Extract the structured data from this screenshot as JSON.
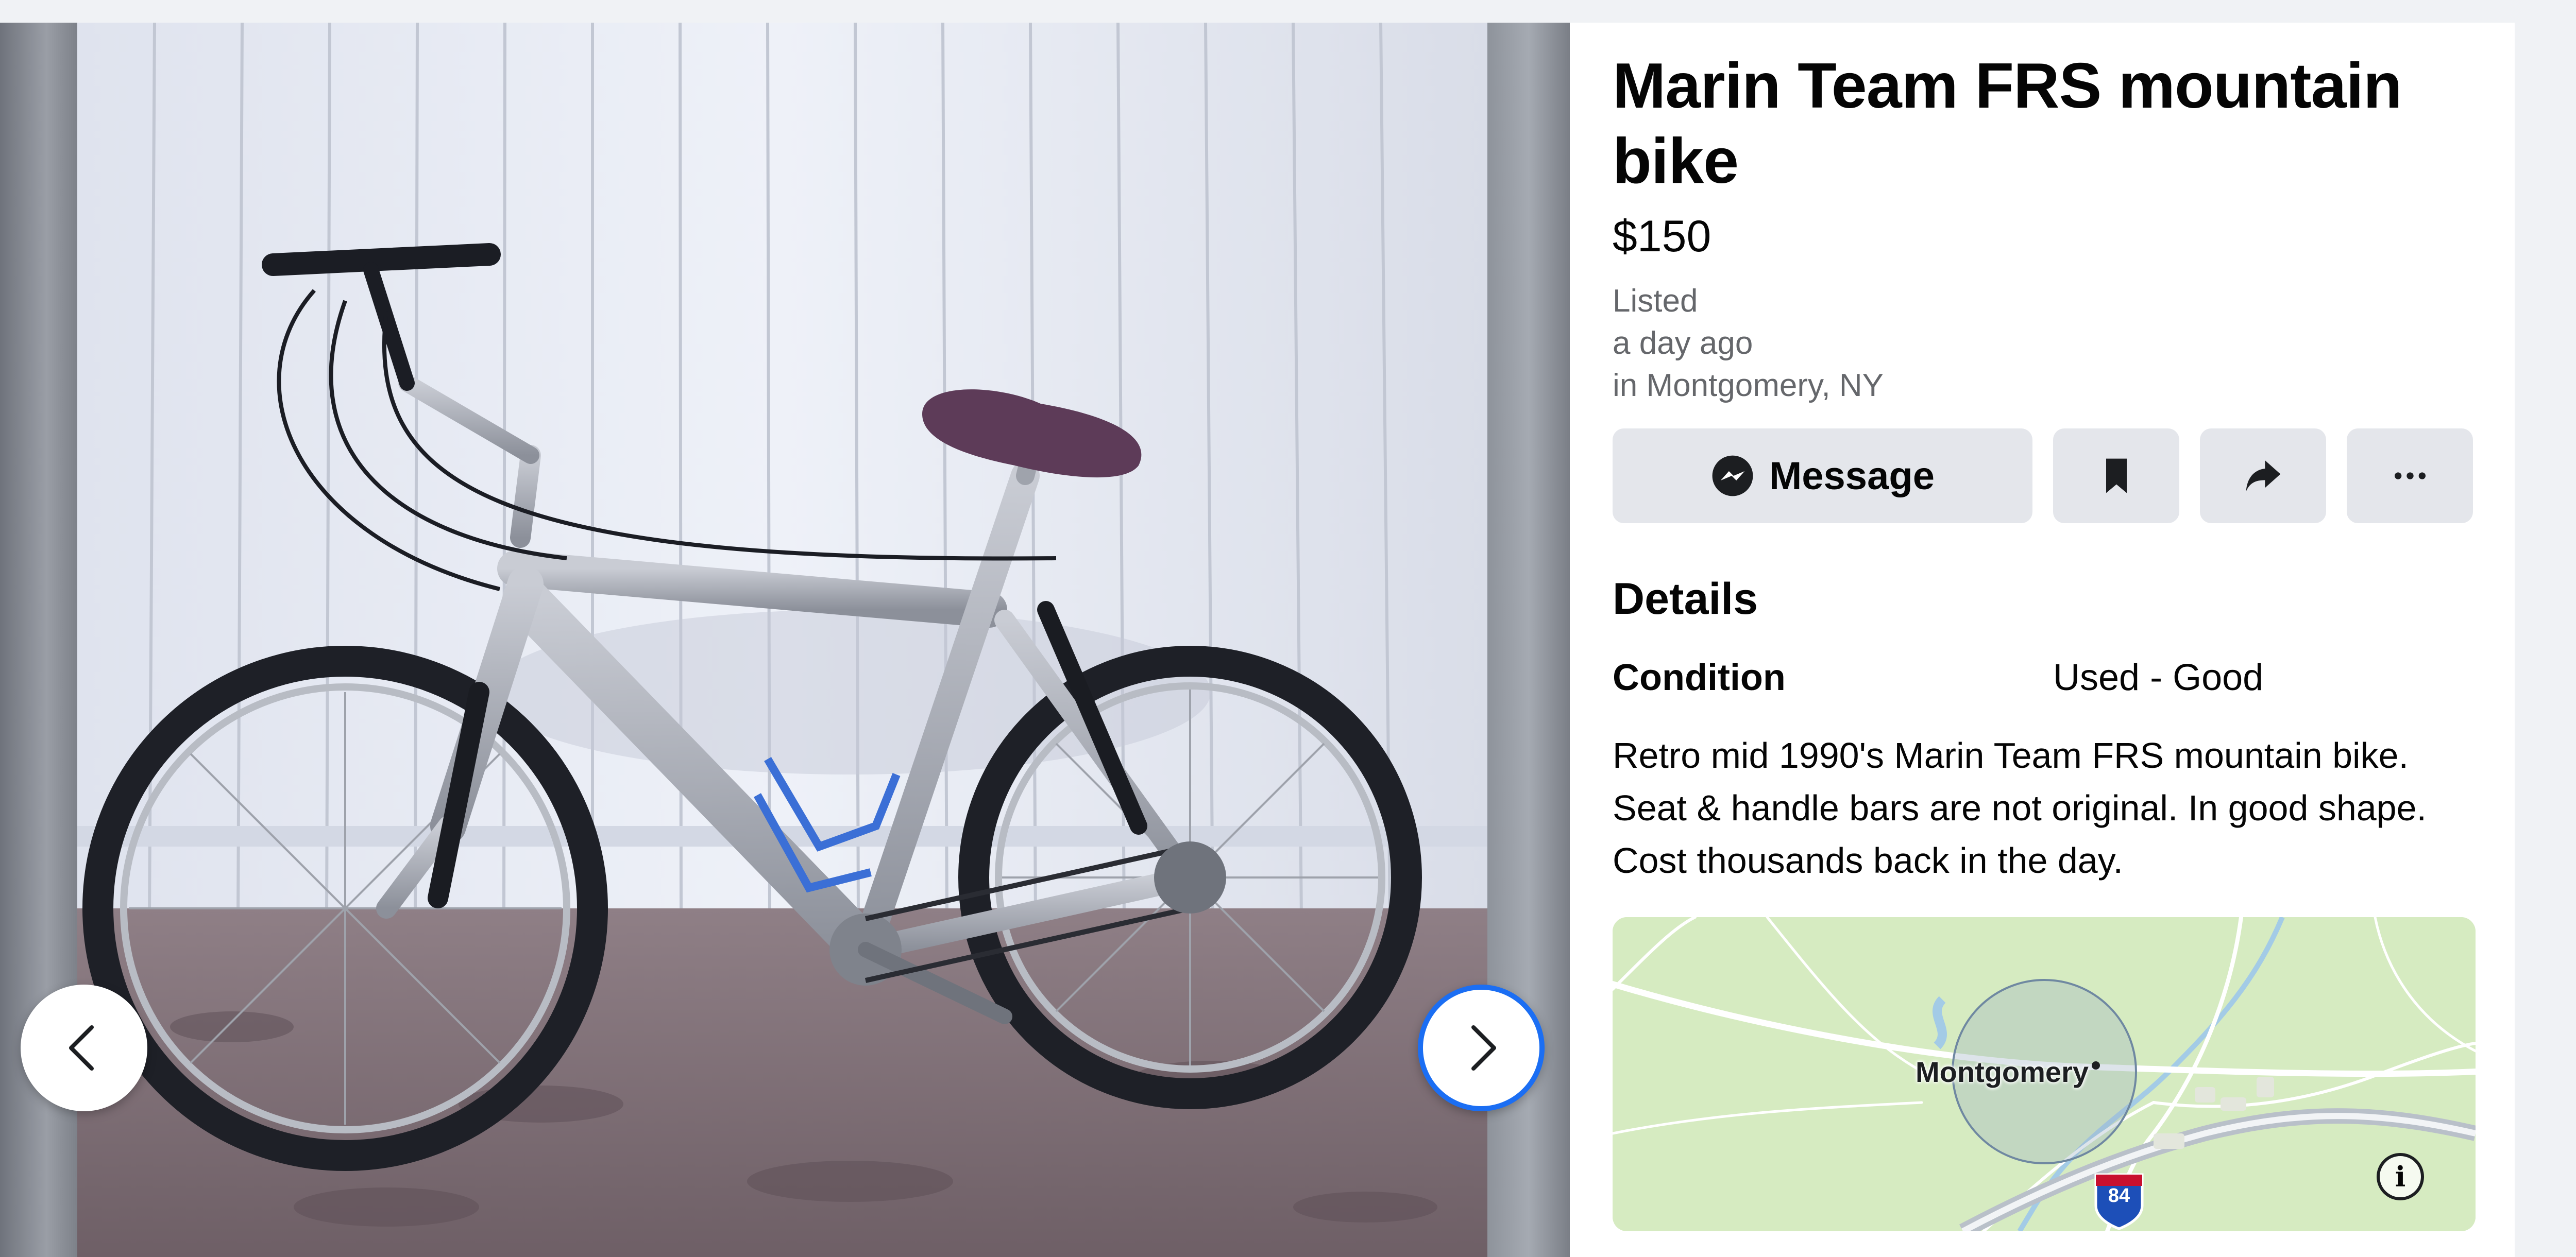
{
  "listing": {
    "title": "Marin Team FRS mountain bike",
    "price": "$150",
    "listed_label": "Listed",
    "listed_time": "a day ago",
    "location": "in Montgomery, NY"
  },
  "actions": {
    "message_label": "Message",
    "save_icon": "bookmark-icon",
    "share_icon": "share-icon",
    "more_icon": "more-icon"
  },
  "details": {
    "heading": "Details",
    "condition_label": "Condition",
    "condition_value": "Used - Good",
    "description": "Retro mid 1990's Marin Team FRS mountain bike. Seat & handle bars are not original. In good shape. Cost thousands back in the day."
  },
  "map": {
    "place_label": "Montgomery",
    "highway_number": "84"
  },
  "colors": {
    "accent": "#1b6ef3",
    "button_bg": "#e4e6eb",
    "secondary_text": "#65676b",
    "map_land": "#d6ebc1"
  }
}
